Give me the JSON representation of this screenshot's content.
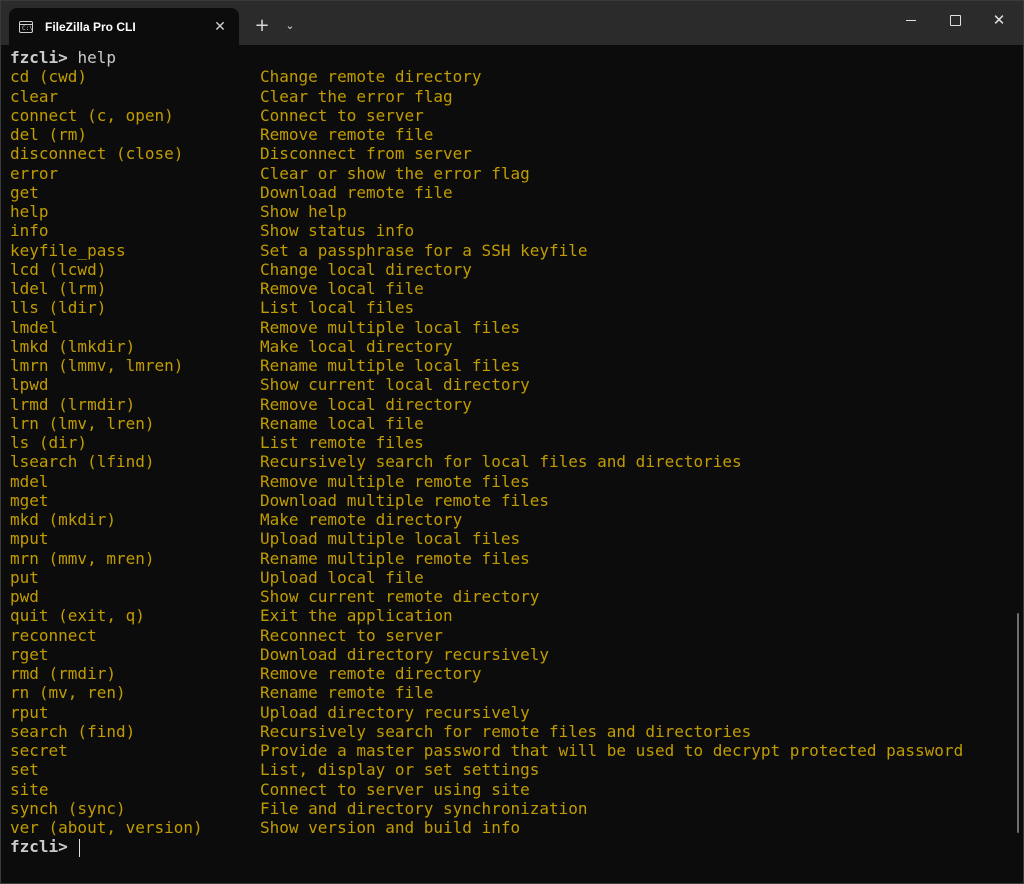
{
  "window": {
    "tab_title": "FileZilla Pro CLI",
    "tab_icon": "terminal-icon",
    "tab_icon_text": "C:\\",
    "close_tab_glyph": "✕",
    "new_tab_glyph": "+",
    "dropdown_glyph": "⌄",
    "close_window_glyph": "✕"
  },
  "terminal": {
    "prompt": "fzcli>",
    "entered_command": "help",
    "text_color": "#c19c00",
    "background": "#0c0c0c",
    "commands": [
      {
        "cmd": "cd (cwd)",
        "desc": "Change remote directory"
      },
      {
        "cmd": "clear",
        "desc": "Clear the error flag"
      },
      {
        "cmd": "connect (c, open)",
        "desc": "Connect to server"
      },
      {
        "cmd": "del (rm)",
        "desc": "Remove remote file"
      },
      {
        "cmd": "disconnect (close)",
        "desc": "Disconnect from server"
      },
      {
        "cmd": "error",
        "desc": "Clear or show the error flag"
      },
      {
        "cmd": "get",
        "desc": "Download remote file"
      },
      {
        "cmd": "help",
        "desc": "Show help"
      },
      {
        "cmd": "info",
        "desc": "Show status info"
      },
      {
        "cmd": "keyfile_pass",
        "desc": "Set a passphrase for a SSH keyfile"
      },
      {
        "cmd": "lcd (lcwd)",
        "desc": "Change local directory"
      },
      {
        "cmd": "ldel (lrm)",
        "desc": "Remove local file"
      },
      {
        "cmd": "lls (ldir)",
        "desc": "List local files"
      },
      {
        "cmd": "lmdel",
        "desc": "Remove multiple local files"
      },
      {
        "cmd": "lmkd (lmkdir)",
        "desc": "Make local directory"
      },
      {
        "cmd": "lmrn (lmmv, lmren)",
        "desc": "Rename multiple local files"
      },
      {
        "cmd": "lpwd",
        "desc": "Show current local directory"
      },
      {
        "cmd": "lrmd (lrmdir)",
        "desc": "Remove local directory"
      },
      {
        "cmd": "lrn (lmv, lren)",
        "desc": "Rename local file"
      },
      {
        "cmd": "ls (dir)",
        "desc": "List remote files"
      },
      {
        "cmd": "lsearch (lfind)",
        "desc": "Recursively search for local files and directories"
      },
      {
        "cmd": "mdel",
        "desc": "Remove multiple remote files"
      },
      {
        "cmd": "mget",
        "desc": "Download multiple remote files"
      },
      {
        "cmd": "mkd (mkdir)",
        "desc": "Make remote directory"
      },
      {
        "cmd": "mput",
        "desc": "Upload multiple local files"
      },
      {
        "cmd": "mrn (mmv, mren)",
        "desc": "Rename multiple remote files"
      },
      {
        "cmd": "put",
        "desc": "Upload local file"
      },
      {
        "cmd": "pwd",
        "desc": "Show current remote directory"
      },
      {
        "cmd": "quit (exit, q)",
        "desc": "Exit the application"
      },
      {
        "cmd": "reconnect",
        "desc": "Reconnect to server"
      },
      {
        "cmd": "rget",
        "desc": "Download directory recursively"
      },
      {
        "cmd": "rmd (rmdir)",
        "desc": "Remove remote directory"
      },
      {
        "cmd": "rn (mv, ren)",
        "desc": "Rename remote file"
      },
      {
        "cmd": "rput",
        "desc": "Upload directory recursively"
      },
      {
        "cmd": "search (find)",
        "desc": "Recursively search for remote files and directories"
      },
      {
        "cmd": "secret",
        "desc": "Provide a master password that will be used to decrypt protected password"
      },
      {
        "cmd": "set",
        "desc": "List, display or set settings"
      },
      {
        "cmd": "site",
        "desc": "Connect to server using site"
      },
      {
        "cmd": "synch (sync)",
        "desc": "File and directory synchronization"
      },
      {
        "cmd": "ver (about, version)",
        "desc": "Show version and build info"
      }
    ]
  }
}
